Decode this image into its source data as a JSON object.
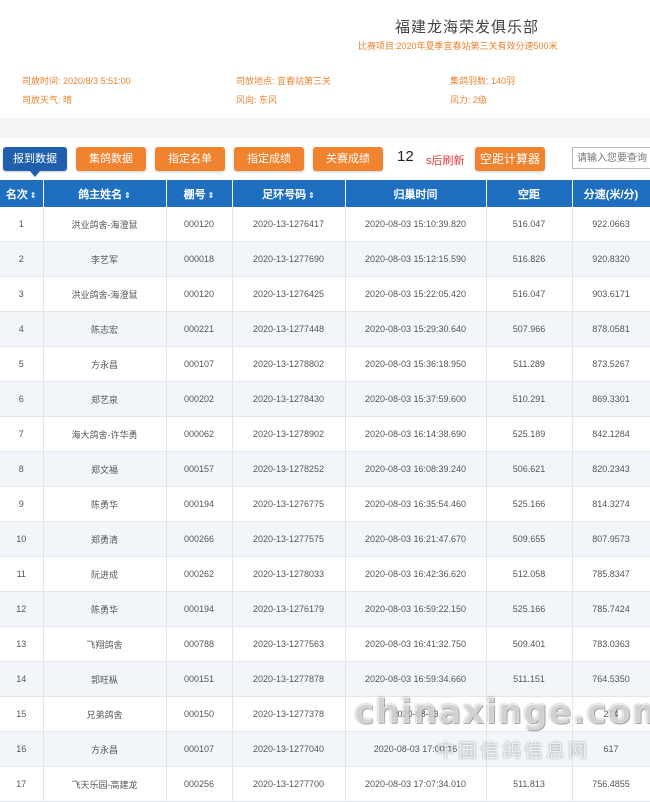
{
  "header": {
    "club_name": "福建龙海荣发俱乐部",
    "race_label": "比赛项目:",
    "race_value": "2020年夏季宜春站第三关有效分速500米",
    "release_time_label": "司放时间:",
    "release_time_value": "2020/8/3 5:51:00",
    "release_place_label": "司放地点:",
    "release_place_value": "宜春站第三关",
    "count_label": "集鸽羽数:",
    "count_value": "140羽",
    "weather_label": "司放天气:",
    "weather_value": "晴",
    "wind_dir_label": "风向:",
    "wind_dir_value": "东风",
    "wind_force_label": "风力:",
    "wind_force_value": "2级"
  },
  "toolbar": {
    "tabs": [
      "报到数据",
      "集鸽数据",
      "指定名单",
      "指定成绩",
      "关赛成绩"
    ],
    "active_tab": "报到数据",
    "refresh_seconds": "12",
    "refresh_text": "s后刷新",
    "calc_button": "空距计算器",
    "search_placeholder": "请输入您要查询"
  },
  "colors": {
    "accent_orange": "#f0832f",
    "active_blue": "#1f5fae",
    "table_header": "#1f6fc0"
  },
  "table": {
    "columns": [
      "名次",
      "鸽主姓名",
      "棚号",
      "足环号码",
      "归巢时间",
      "空距",
      "分速(米/分)"
    ],
    "rows": [
      [
        "1",
        "洪业鸽舍-海澄鼠",
        "000120",
        "2020-13-1276417",
        "2020-08-03 15:10:39.820",
        "516.047",
        "922.0663"
      ],
      [
        "2",
        "李艺军",
        "000018",
        "2020-13-1277690",
        "2020-08-03 15:12:15.590",
        "516.826",
        "920.8320"
      ],
      [
        "3",
        "洪业鸽舍-海澄鼠",
        "000120",
        "2020-13-1276425",
        "2020-08-03 15:22:05.420",
        "516.047",
        "903.6171"
      ],
      [
        "4",
        "陈志宏",
        "000221",
        "2020-13-1277448",
        "2020-08-03 15:29:30.640",
        "507.966",
        "878.0581"
      ],
      [
        "5",
        "方永昌",
        "000107",
        "2020-13-1278802",
        "2020-08-03 15:36:18.950",
        "511.289",
        "873.5267"
      ],
      [
        "6",
        "郑艺泉",
        "000202",
        "2020-13-1278430",
        "2020-08-03 15:37:59.600",
        "510.291",
        "869.3301"
      ],
      [
        "7",
        "海大鸽舍-许华勇",
        "000062",
        "2020-13-1278902",
        "2020-08-03 16:14:38.690",
        "525.189",
        "842.1284"
      ],
      [
        "8",
        "郑文福",
        "000157",
        "2020-13-1278252",
        "2020-08-03 16:08:39.240",
        "506.621",
        "820.2343"
      ],
      [
        "9",
        "陈勇华",
        "000194",
        "2020-13-1276775",
        "2020-08-03 16:35:54.460",
        "525.166",
        "814.3274"
      ],
      [
        "10",
        "郑勇清",
        "000266",
        "2020-13-1277575",
        "2020-08-03 16:21:47.670",
        "509.655",
        "807.9573"
      ],
      [
        "11",
        "阮进成",
        "000262",
        "2020-13-1278033",
        "2020-08-03 16:42:36.620",
        "512.058",
        "785.8347"
      ],
      [
        "12",
        "陈勇华",
        "000194",
        "2020-13-1276179",
        "2020-08-03 16:59:22.150",
        "525.166",
        "785.7424"
      ],
      [
        "13",
        "飞翔鸽舍",
        "000788",
        "2020-13-1277563",
        "2020-08-03 16:41:32.750",
        "509.401",
        "783.0363"
      ],
      [
        "14",
        "郭旺枞",
        "000151",
        "2020-13-1277878",
        "2020-08-03 16:59:34.660",
        "511.151",
        "764.5350"
      ],
      [
        "15",
        "兄弟鸽舍",
        "000150",
        "2020-13-1277378",
        "2020-08-03 ",
        "",
        "274"
      ],
      [
        "16",
        "方永昌",
        "000107",
        "2020-13-1277040",
        "2020-08-03 17:00:16",
        "",
        "617"
      ],
      [
        "17",
        "飞天乐园-高建龙",
        "000256",
        "2020-13-1277700",
        "2020-08-03 17:07:34.010",
        "511.813",
        "756.4855"
      ]
    ]
  },
  "watermark": {
    "en": "chinaxinge.com",
    "cn": "中国信鸽信息网"
  }
}
